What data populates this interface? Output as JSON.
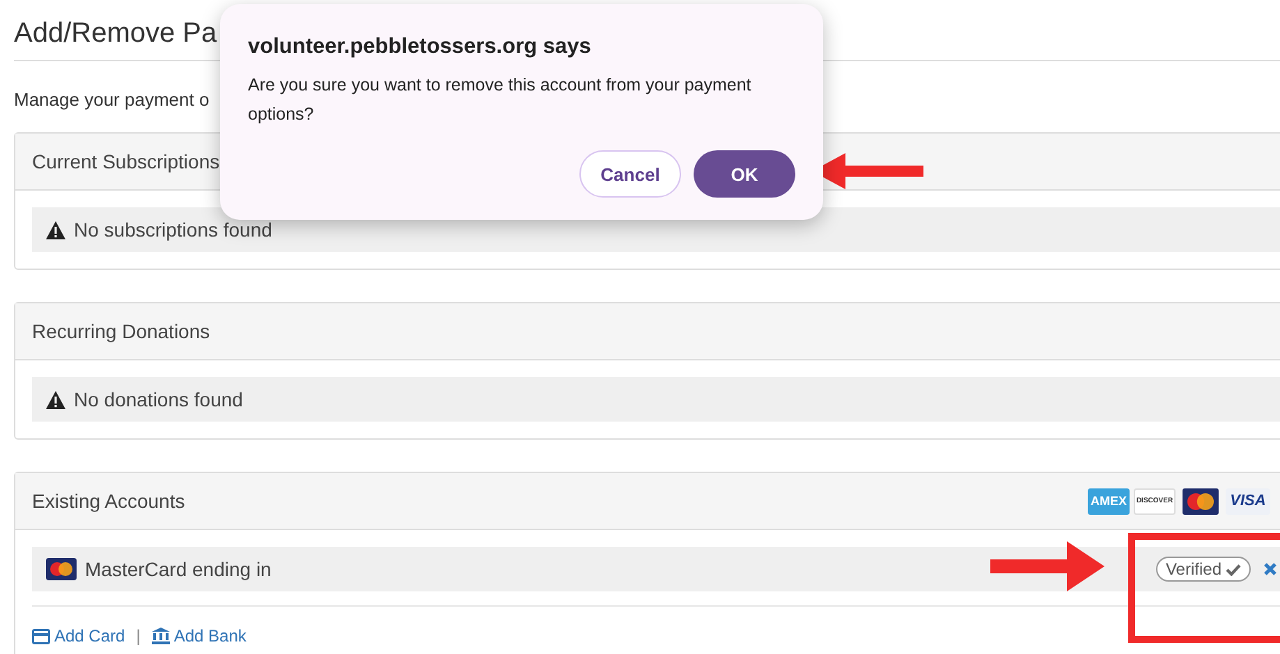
{
  "page": {
    "title": "Add/Remove Pa",
    "intro": "Manage your payment o"
  },
  "panels": [
    {
      "kind": "notice",
      "title": "Current Subscriptions",
      "message": "No subscriptions found"
    },
    {
      "kind": "notice",
      "title": "Recurring Donations",
      "message": "No donations found"
    },
    {
      "kind": "accounts",
      "title": "Existing Accounts",
      "card_logos": [
        {
          "kind": "amex",
          "text": "AMEX"
        },
        {
          "kind": "discover",
          "text": "DISCOVER"
        },
        {
          "kind": "mastercard"
        },
        {
          "kind": "visa",
          "text": "VISA"
        }
      ],
      "accounts": [
        {
          "label": "MasterCard ending in",
          "status": "Verified"
        }
      ],
      "links": [
        {
          "kind": "card",
          "label": "Add Card"
        },
        {
          "kind": "bank",
          "label": "Add Bank"
        }
      ],
      "link_separator": "|"
    }
  ],
  "dialog": {
    "title": "volunteer.pebbletossers.org says",
    "message": "Are you sure you want to remove this account from your payment options?",
    "buttons": [
      {
        "kind": "secondary",
        "label": "Cancel"
      },
      {
        "kind": "primary",
        "label": "OK"
      }
    ]
  }
}
